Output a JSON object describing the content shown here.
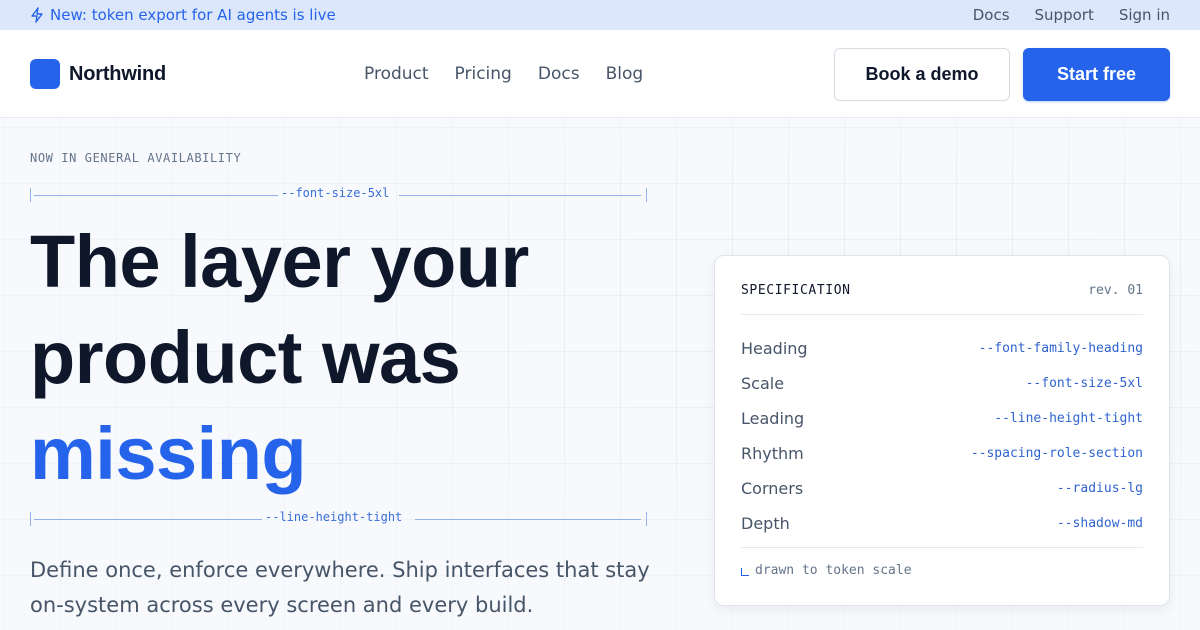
{
  "announcement": {
    "text": "New: token export for AI agents is live",
    "icon": "bolt-icon",
    "links": [
      "Docs",
      "Support",
      "Sign in"
    ]
  },
  "header": {
    "brand": "Northwind",
    "nav": [
      "Product",
      "Pricing",
      "Docs",
      "Blog"
    ],
    "secondary_cta": "Book a demo",
    "primary_cta": "Start free"
  },
  "hero": {
    "eyebrow": "NOW IN GENERAL AVAILABILITY",
    "measure_top": "--font-size-5xl",
    "headline_line1": "The layer your",
    "headline_line2": "product was",
    "headline_accent": "missing",
    "measure_bottom": "--line-height-tight",
    "subtext": "Define once, enforce everywhere. Ship interfaces that stay on-system across every screen and every build."
  },
  "spec_card": {
    "title": "SPECIFICATION",
    "revision": "rev. 01",
    "rows": [
      {
        "label": "Heading",
        "token": "--font-family-heading"
      },
      {
        "label": "Scale",
        "token": "--font-size-5xl"
      },
      {
        "label": "Leading",
        "token": "--line-height-tight"
      },
      {
        "label": "Rhythm",
        "token": "--spacing-role-section"
      },
      {
        "label": "Corners",
        "token": "--radius-lg"
      },
      {
        "label": "Depth",
        "token": "--shadow-md"
      }
    ],
    "footer": "drawn to token scale"
  },
  "colors": {
    "accent": "#2563eb",
    "text": "#0f172a",
    "muted": "#475569",
    "announcement_bg": "#dde7fb"
  }
}
